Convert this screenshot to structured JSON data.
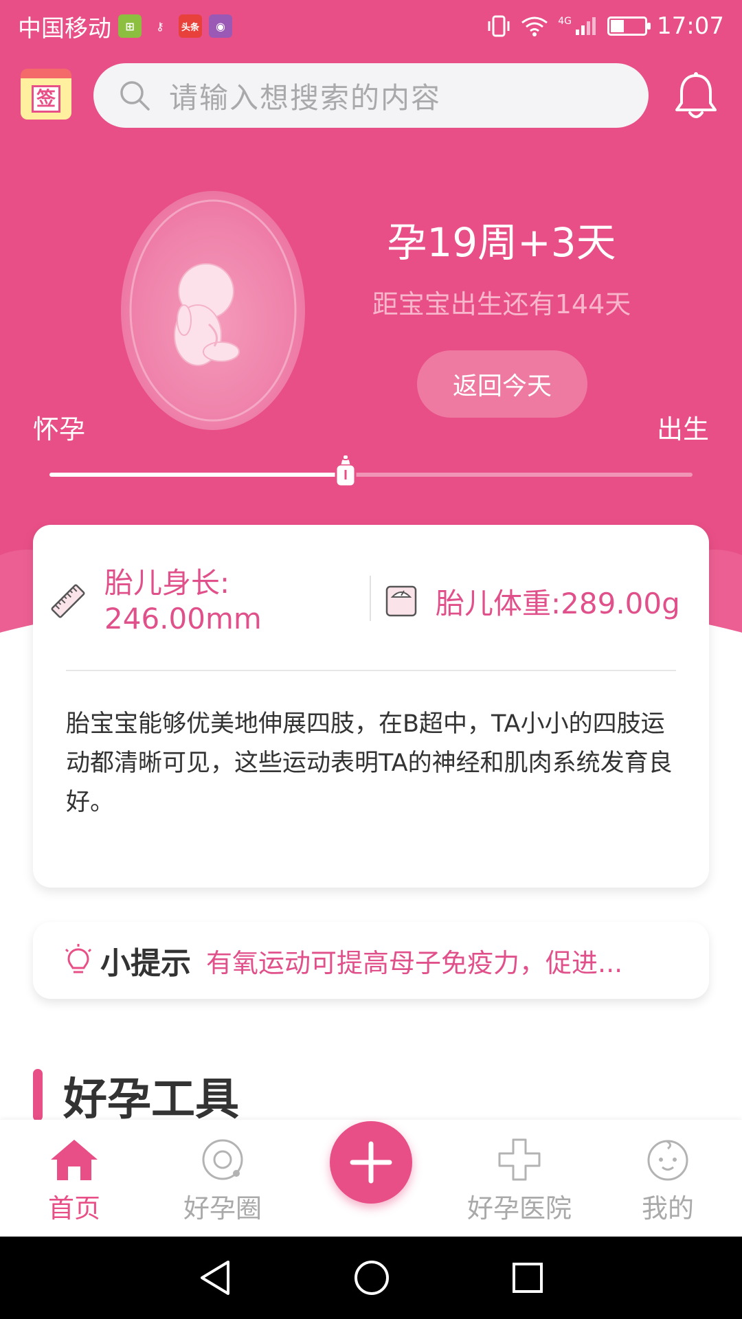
{
  "status_bar": {
    "carrier": "中国移动",
    "apps": [
      {
        "name": "app-icon-1",
        "glyph": "⊞",
        "color": "#8cbf3f"
      },
      {
        "name": "key-icon",
        "glyph": "⚷",
        "color": "transparent"
      },
      {
        "name": "toutiao-icon",
        "glyph": "头条",
        "color": "#e8403a"
      },
      {
        "name": "game-icon",
        "glyph": "◉",
        "color": "#9b59b6"
      }
    ],
    "network": "4G",
    "battery_level": 0.4,
    "time": "17:07"
  },
  "top_bar": {
    "signin_label": "签",
    "search_placeholder": "请输入想搜索的内容"
  },
  "pregnancy": {
    "week_title": "孕19周+3天",
    "countdown": "距宝宝出生还有144天",
    "back_today": "返回今天",
    "start_label": "怀孕",
    "end_label": "出生",
    "progress": 0.46
  },
  "card": {
    "length_label": "胎儿身长:",
    "length_value": "246.00mm",
    "weight_label": "胎儿体重:289.00g",
    "description": "胎宝宝能够优美地伸展四肢，在B超中，TA小小的四肢运动都清晰可见，这些运动表明TA的神经和肌肉系统发育良好。"
  },
  "tip": {
    "title": "小提示",
    "text": "有氧运动可提高母子免疫力，促进..."
  },
  "section": {
    "title": "好孕工具"
  },
  "bottom_nav": {
    "items": [
      {
        "label": "首页",
        "icon": "home-icon",
        "active": true
      },
      {
        "label": "好孕圈",
        "icon": "circle-icon",
        "active": false
      },
      {
        "label": "好孕医院",
        "icon": "hospital-cross-icon",
        "active": false
      },
      {
        "label": "我的",
        "icon": "baby-face-icon",
        "active": false
      }
    ],
    "fab_icon": "plus-icon"
  },
  "colors": {
    "brand": "#e84f86",
    "accent_text": "#e0508a"
  }
}
